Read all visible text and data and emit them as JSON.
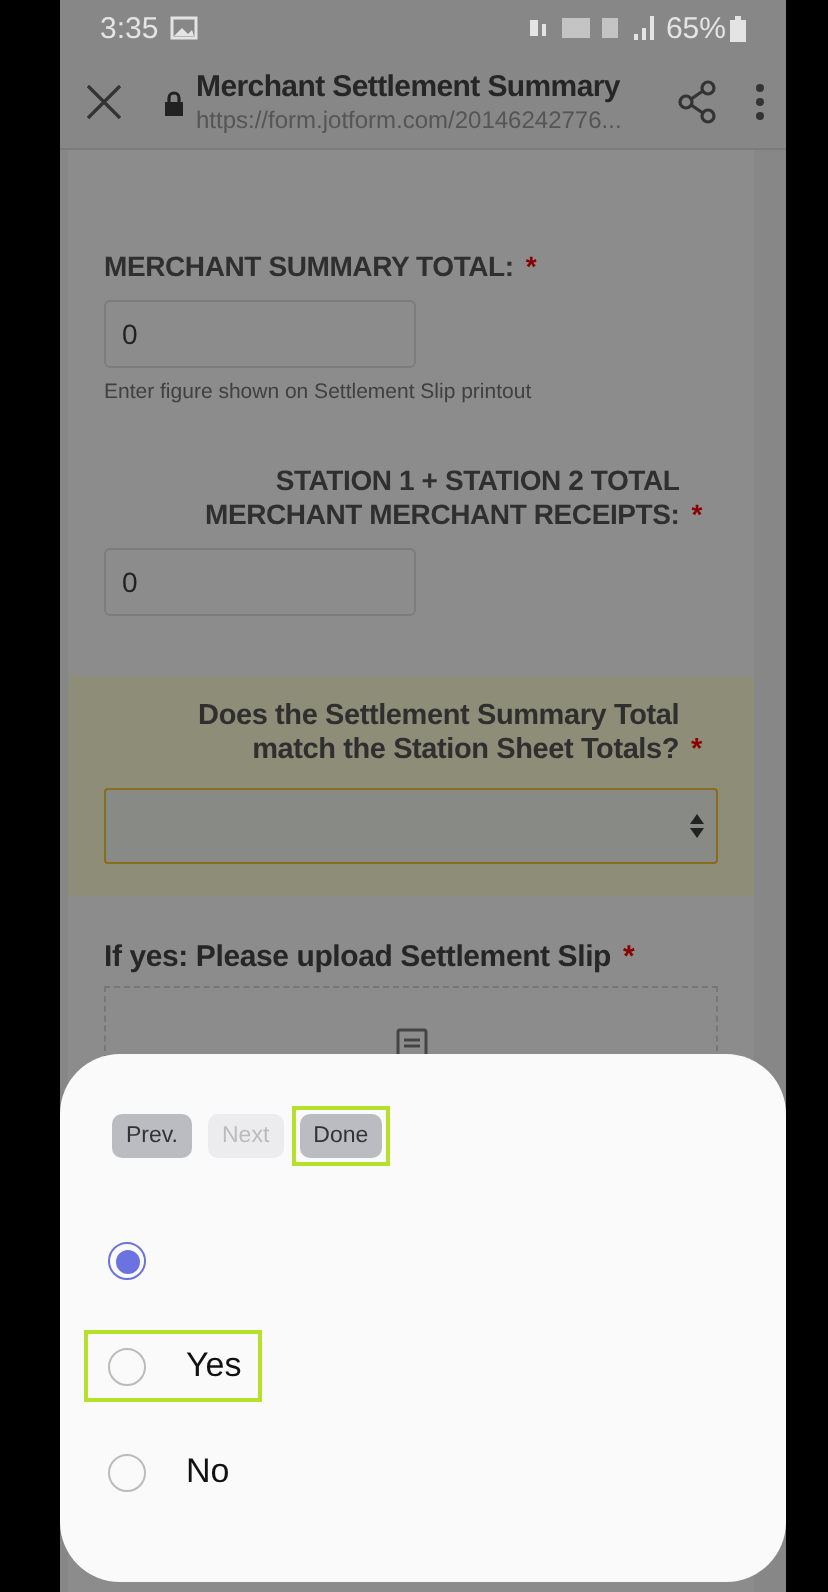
{
  "status_bar": {
    "time": "3:35",
    "battery": "65%"
  },
  "browser": {
    "title": "Merchant Settlement Summary",
    "url": "https://form.jotform.com/20146242776..."
  },
  "form": {
    "fields": [
      {
        "kind": "text",
        "label": "MERCHANT SUMMARY TOTAL:",
        "required_mark": "*",
        "value": "0",
        "hint": "Enter figure shown on Settlement Slip printout",
        "right_aligned": false
      },
      {
        "kind": "text",
        "label": "STATION 1 + STATION 2 TOTAL MERCHANT MERCHANT RECEIPTS:",
        "required_mark": "*",
        "value": "0",
        "right_aligned": true
      },
      {
        "kind": "select",
        "label": "Does the Settlement Summary Total match the Station Sheet Totals?",
        "required_mark": "*",
        "focused": true,
        "right_aligned": true
      },
      {
        "kind": "upload",
        "label": "If yes: Please upload Settlement Slip",
        "required_mark": "*",
        "right_aligned": false
      }
    ]
  },
  "picker": {
    "buttons": [
      {
        "label": "Prev.",
        "disabled": false,
        "highlighted": false
      },
      {
        "label": "Next",
        "disabled": true,
        "highlighted": false
      },
      {
        "label": "Done",
        "disabled": false,
        "highlighted": true
      }
    ],
    "options": [
      {
        "selected": true,
        "highlighted": false
      },
      {
        "label": "Yes",
        "selected": false,
        "highlighted": true
      },
      {
        "label": "No",
        "selected": false,
        "highlighted": false
      }
    ]
  }
}
